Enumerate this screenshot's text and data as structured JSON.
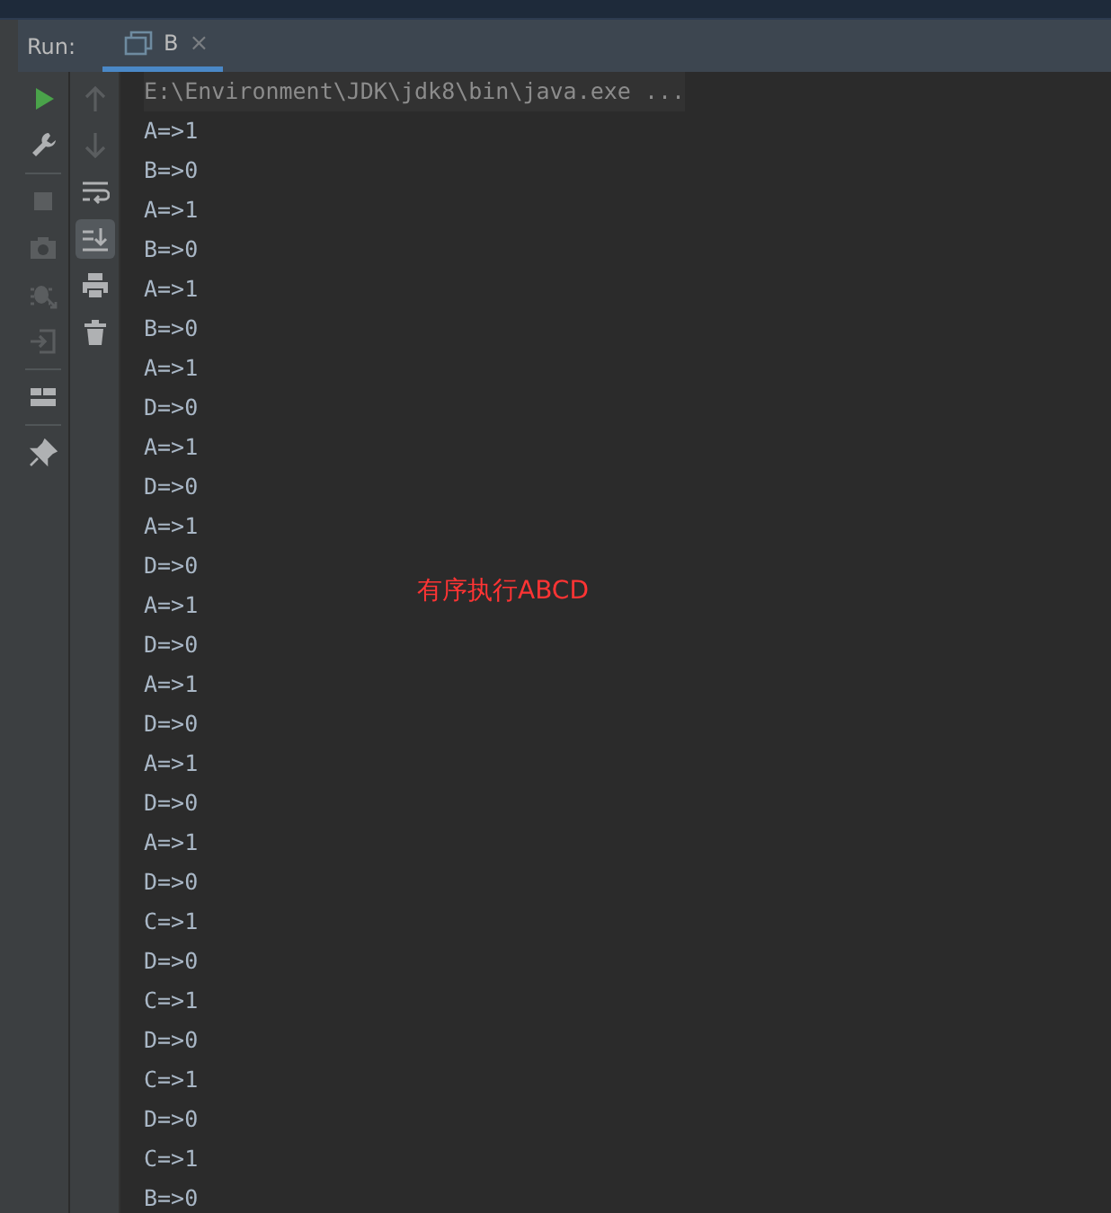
{
  "run_panel": {
    "label": "Run:",
    "tabs": [
      {
        "label": "B",
        "selected": true,
        "close": "×"
      }
    ]
  },
  "toolbar_left": [
    {
      "kind": "run",
      "disabled": false
    },
    {
      "kind": "wrench",
      "disabled": false
    },
    {
      "kind": "sep"
    },
    {
      "kind": "stop",
      "disabled": true
    },
    {
      "kind": "camera",
      "disabled": true
    },
    {
      "kind": "bug",
      "disabled": true
    },
    {
      "kind": "enter",
      "disabled": true
    },
    {
      "kind": "sep"
    },
    {
      "kind": "layout",
      "disabled": false
    },
    {
      "kind": "sep"
    },
    {
      "kind": "pin",
      "disabled": false
    }
  ],
  "toolbar_right": [
    {
      "kind": "up",
      "disabled": true,
      "selected": false
    },
    {
      "kind": "down",
      "disabled": true,
      "selected": false
    },
    {
      "kind": "wrap",
      "disabled": false,
      "selected": false
    },
    {
      "kind": "scroll",
      "disabled": false,
      "selected": true
    },
    {
      "kind": "print",
      "disabled": false,
      "selected": false
    },
    {
      "kind": "trash",
      "disabled": false,
      "selected": false
    }
  ],
  "console": {
    "command": "E:\\Environment\\JDK\\jdk8\\bin\\java.exe ...",
    "lines": [
      "A=>1",
      "B=>0",
      "A=>1",
      "B=>0",
      "A=>1",
      "B=>0",
      "A=>1",
      "D=>0",
      "A=>1",
      "D=>0",
      "A=>1",
      "D=>0",
      "A=>1",
      "D=>0",
      "A=>1",
      "D=>0",
      "A=>1",
      "D=>0",
      "A=>1",
      "D=>0",
      "C=>1",
      "D=>0",
      "C=>1",
      "D=>0",
      "C=>1",
      "D=>0",
      "C=>1",
      "B=>0"
    ],
    "annotation": "有序执行ABCD"
  }
}
